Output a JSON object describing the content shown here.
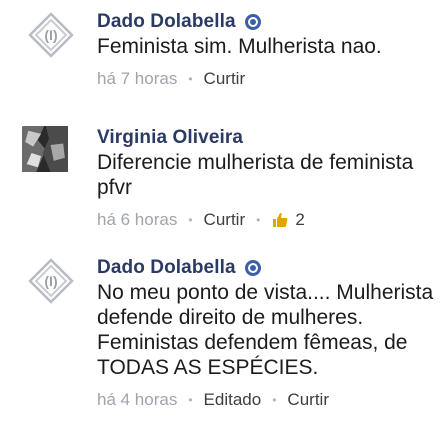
{
  "comments": [
    {
      "author": "Dado Dolabella",
      "verified": true,
      "text": "Feminista sim. Mulherista nao.",
      "time": "há 7 horas",
      "actions": [
        "Curtir"
      ]
    },
    {
      "author": "Virginia Oliveira",
      "verified": false,
      "text": "Diferencie mulherista de feminista pfvr",
      "time": "há 6 horas",
      "actions": [
        "Curtir"
      ],
      "likes": "2"
    },
    {
      "author": "Dado Dolabella",
      "verified": true,
      "text": "No meu ponto de vista.... Mulherista defende direito de mulheres. Feministas defendem fêmeas, de TODAS AS ESPÉCIES.",
      "time": "há 4 horas",
      "actions": [
        "Editado",
        "Curtir"
      ]
    }
  ],
  "colors": {
    "name": "#2b3a63",
    "verified": "#3b5fa8",
    "like": "#e3a400",
    "meta": "#a0a4ac"
  },
  "icons": {
    "avatar_logo": "diamond-logo-icon",
    "verified": "verified-check-icon",
    "like": "thumbs-up-icon"
  }
}
